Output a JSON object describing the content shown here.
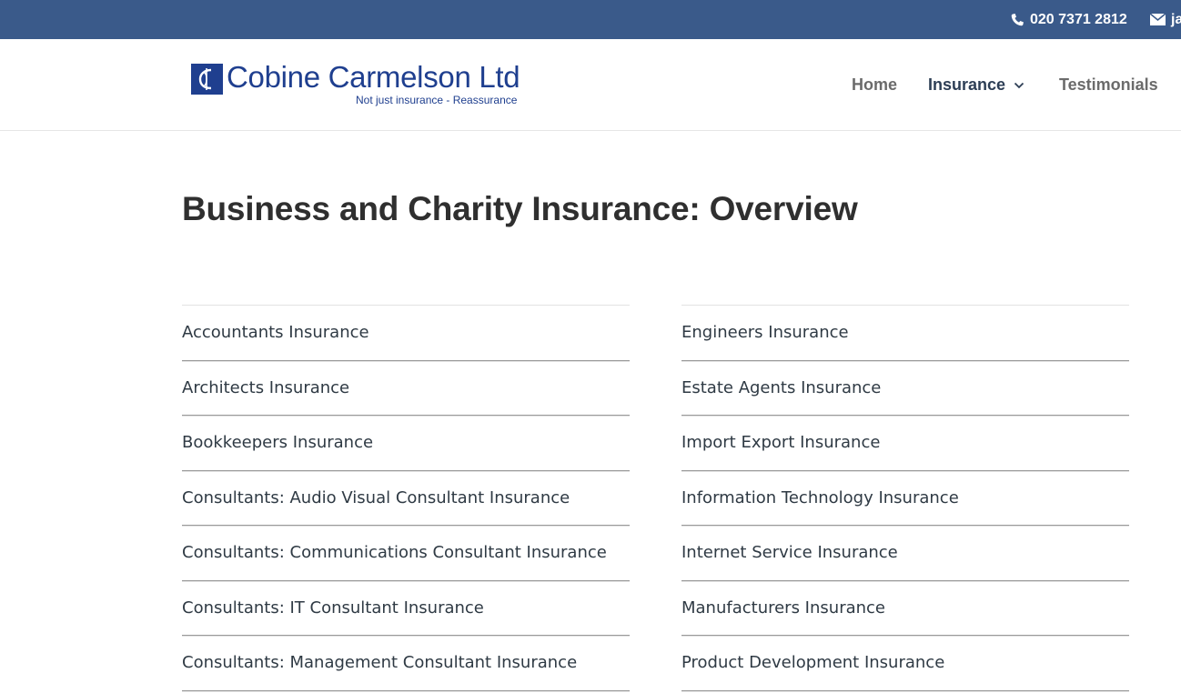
{
  "topbar": {
    "phone": "020 7371 2812",
    "email": "ja",
    "bg_color": "#3a5a8a"
  },
  "logo": {
    "name": "Cobine Carmelson Ltd",
    "tagline": "Not just insurance - Reassurance",
    "color": "#1f3f8f"
  },
  "nav": {
    "home": "Home",
    "insurance": "Insurance",
    "testimonials": "Testimonials"
  },
  "page": {
    "title": "Business and Charity Insurance: Overview"
  },
  "lists": {
    "left": [
      "Accountants Insurance",
      "Architects Insurance",
      "Bookkeepers Insurance",
      "Consultants: Audio Visual Consultant Insurance",
      "Consultants: Communications Consultant Insurance",
      "Consultants: IT Consultant Insurance",
      "Consultants: Management Consultant Insurance"
    ],
    "right": [
      "Engineers Insurance",
      "Estate Agents Insurance",
      "Import Export Insurance",
      "Information Technology Insurance",
      "Internet Service Insurance",
      "Manufacturers Insurance",
      "Product Development Insurance"
    ]
  }
}
